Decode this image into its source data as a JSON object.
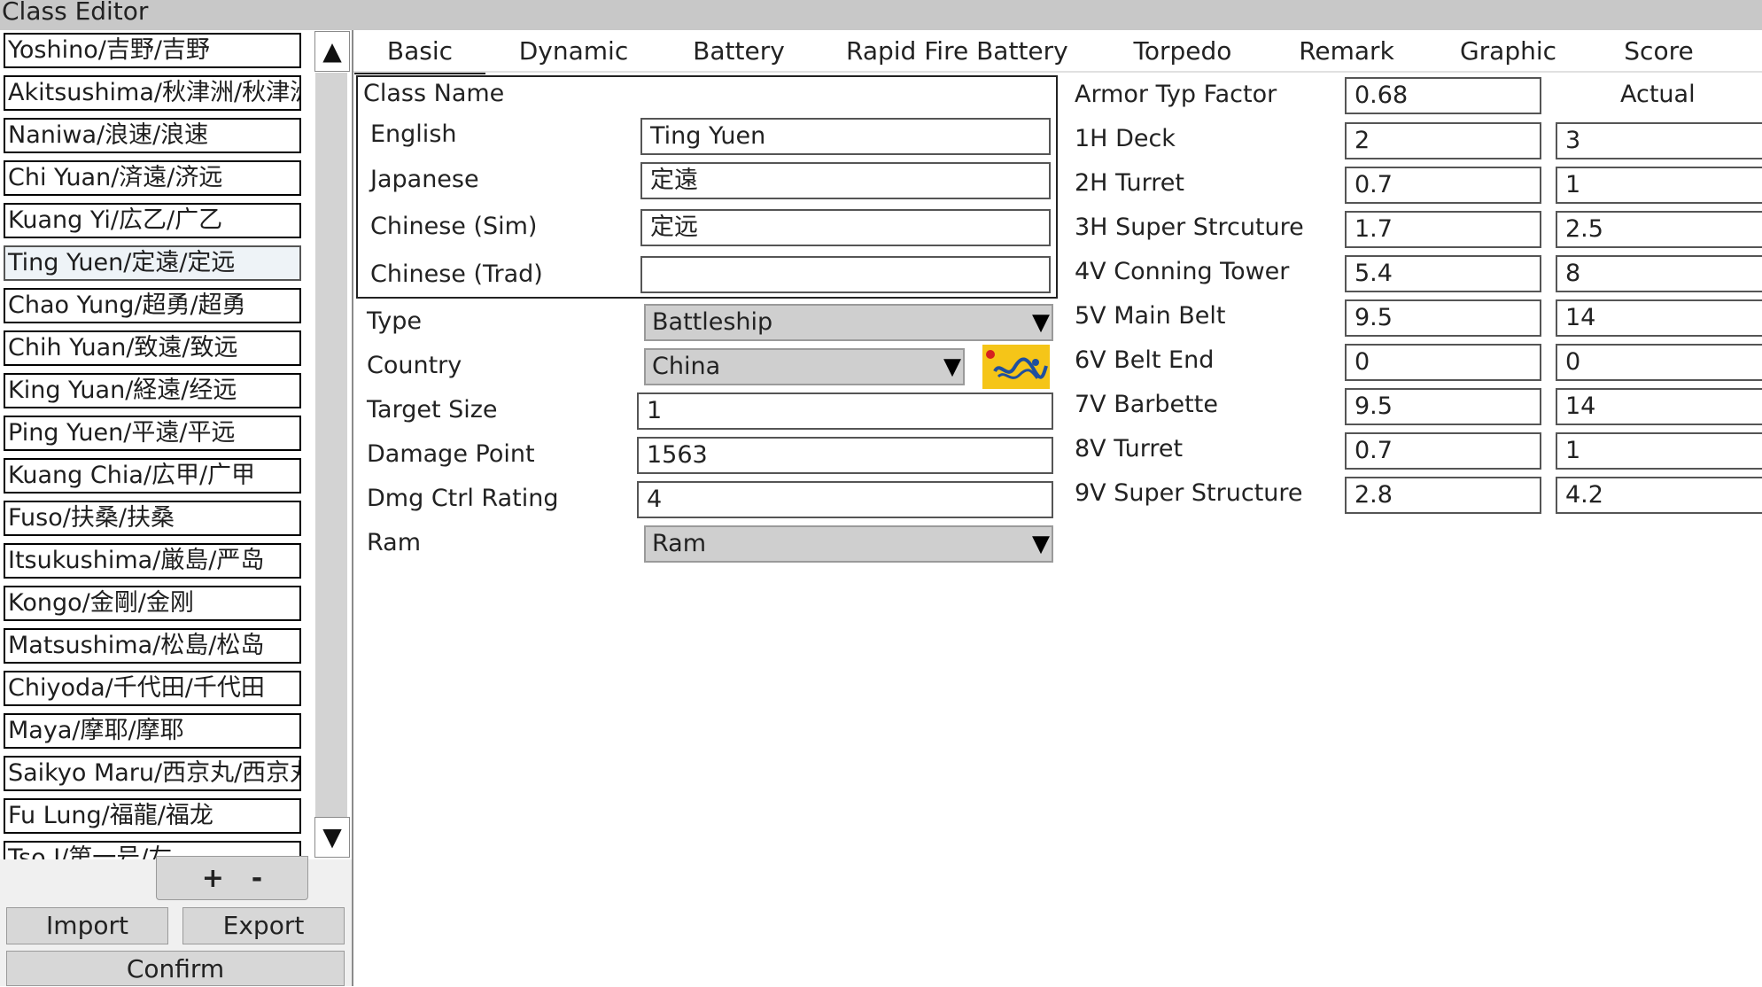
{
  "window": {
    "title": "Class Editor"
  },
  "ship_list": [
    "Yoshino/吉野/吉野",
    "Akitsushima/秋津洲/秋津洲",
    "Naniwa/浪速/浪速",
    "Chi Yuan/済遠/济远",
    "Kuang Yi/広乙/广乙",
    "Ting Yuen/定遠/定远",
    "Chao Yung/超勇/超勇",
    "Chih Yuan/致遠/致远",
    "King Yuan/経遠/经远",
    "Ping Yuen/平遠/平远",
    "Kuang Chia/広甲/广甲",
    "Fuso/扶桑/扶桑",
    "Itsukushima/厳島/严岛",
    "Kongo/金剛/金刚",
    "Matsushima/松島/松岛",
    "Chiyoda/千代田/千代田",
    "Maya/摩耶/摩耶",
    "Saikyo Maru/西京丸/西京丸",
    "Fu Lung/福龍/福龙",
    "Tso I/第一号/左"
  ],
  "selected_ship": "Ting Yuen/定遠/定远",
  "scroll": {
    "up": "▲",
    "down": "▼"
  },
  "buttons": {
    "add": "+",
    "remove": "-",
    "import": "Import",
    "export": "Export",
    "confirm": "Confirm"
  },
  "tabs": [
    "Basic",
    "Dynamic",
    "Battery",
    "Rapid Fire Battery",
    "Torpedo",
    "Remark",
    "Graphic",
    "Score"
  ],
  "active_tab": "Basic",
  "class_name": {
    "heading": "Class Name",
    "rows": [
      {
        "label": "English",
        "value": "Ting Yuen"
      },
      {
        "label": "Japanese",
        "value": "定遠"
      },
      {
        "label": "Chinese (Sim)",
        "value": "定远"
      },
      {
        "label": "Chinese (Trad)",
        "value": ""
      }
    ]
  },
  "basic": {
    "type": {
      "label": "Type",
      "value": "Battleship"
    },
    "country": {
      "label": "Country",
      "value": "China",
      "flag": "qing-dragon-flag"
    },
    "target_size": {
      "label": "Target Size",
      "value": "1"
    },
    "damage_point": {
      "label": "Damage Point",
      "value": "1563"
    },
    "dmg_ctrl": {
      "label": "Dmg Ctrl Rating",
      "value": "4"
    },
    "ram": {
      "label": "Ram",
      "value": "Ram"
    }
  },
  "armor": {
    "factor_label": "Armor Typ Factor",
    "factor_value": "0.68",
    "actual_label": "Actual",
    "rows": [
      {
        "label": "1H Deck",
        "value": "2",
        "actual": "3"
      },
      {
        "label": "2H Turret",
        "value": "0.7",
        "actual": "1"
      },
      {
        "label": "3H Super Strcuture",
        "value": "1.7",
        "actual": "2.5"
      },
      {
        "label": "4V Conning Tower",
        "value": "5.4",
        "actual": "8"
      },
      {
        "label": "5V Main Belt",
        "value": "9.5",
        "actual": "14"
      },
      {
        "label": "6V Belt End",
        "value": "0",
        "actual": "0"
      },
      {
        "label": "7V Barbette",
        "value": "9.5",
        "actual": "14"
      },
      {
        "label": "8V Turret",
        "value": "0.7",
        "actual": "1"
      },
      {
        "label": "9V Super Structure",
        "value": "2.8",
        "actual": "4.2"
      }
    ]
  },
  "colors": {
    "flag_yellow": "#f5c518",
    "dragon_blue": "#1f4f9e",
    "pearl_red": "#d62020"
  }
}
